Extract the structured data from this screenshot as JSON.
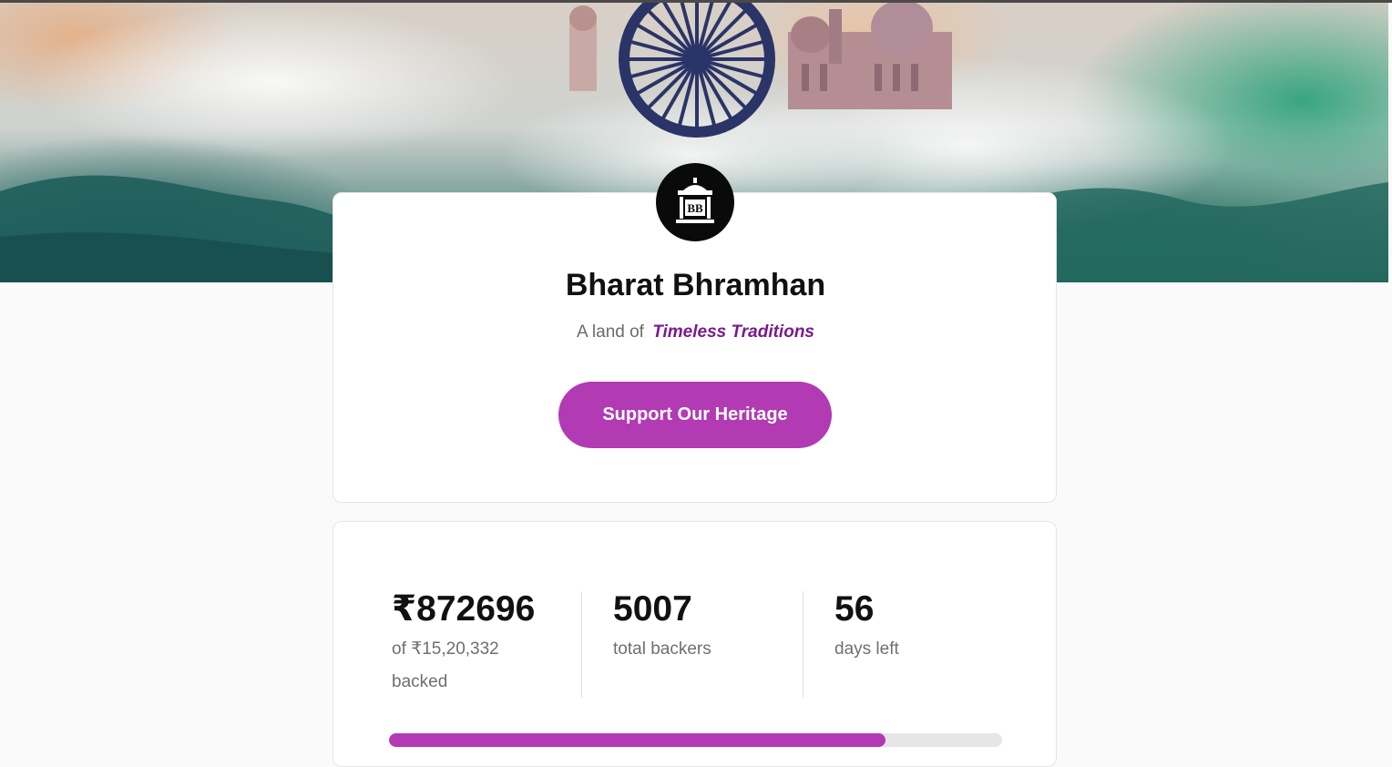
{
  "hero": {
    "image": "hero-banner-ashoka-chakra-palace-clouds"
  },
  "campaign": {
    "logo_text": "BB",
    "title": "Bharat Bhramhan",
    "tagline_prefix": "A land of",
    "tagline_highlight": "Timeless Traditions",
    "cta_label": "Support Our Heritage"
  },
  "stats": {
    "pledged": {
      "value": "₹872696",
      "label_line1": "of ₹15,20,332",
      "label_line2": "backed"
    },
    "backers": {
      "value": "5007",
      "label": "total backers"
    },
    "days": {
      "value": "56",
      "label": "days left"
    },
    "progress_fraction": 0.81
  },
  "colors": {
    "accent": "#b23ab3",
    "highlight_text": "#7a1a8c",
    "background": "#fafafa"
  }
}
